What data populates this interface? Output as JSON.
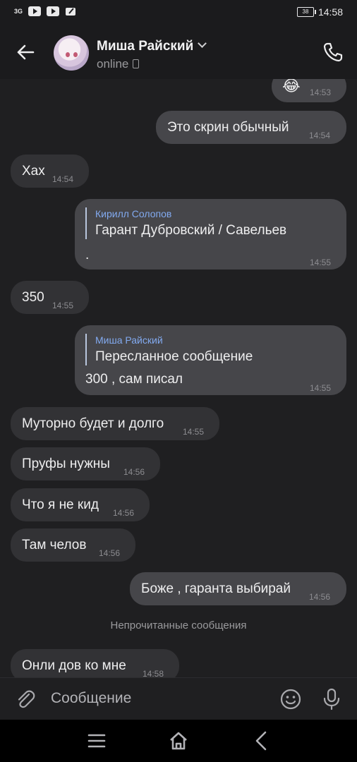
{
  "status_bar": {
    "signal": "3G",
    "battery": "38",
    "time": "14:58"
  },
  "header": {
    "contact_name": "Миша Райский",
    "status": "online"
  },
  "messages": [
    {
      "side": "out",
      "text": "😂",
      "time": "14:53"
    },
    {
      "side": "out",
      "text": "Это скрин обычный",
      "time": "14:54"
    },
    {
      "side": "in",
      "text": "Хах",
      "time": "14:54"
    },
    {
      "side": "out",
      "quote_author": "Кирилл Солопов",
      "quote_text": "Гарант Дубровский / Савельев",
      "text": ".",
      "time": "14:55"
    },
    {
      "side": "in",
      "text": "350",
      "time": "14:55"
    },
    {
      "side": "out",
      "quote_author": "Миша Райский",
      "quote_text": "Пересланное сообщение",
      "text": "300 , сам писал",
      "time": "14:55"
    },
    {
      "side": "in",
      "text": "Муторно будет и долго",
      "time": "14:55"
    },
    {
      "side": "in",
      "text": "Пруфы нужны",
      "time": "14:56"
    },
    {
      "side": "in",
      "text": "Что я не кид",
      "time": "14:56"
    },
    {
      "side": "in",
      "text": "Там челов",
      "time": "14:56"
    },
    {
      "side": "out",
      "text": "Боже , гаранта выбирай",
      "time": "14:56"
    },
    {
      "side": "in",
      "text": "Онли дов ко мне",
      "time": "14:58"
    }
  ],
  "unread_divider": "Непрочитанные сообщения",
  "composer": {
    "placeholder": "Сообщение"
  },
  "colors": {
    "background": "#1f1f21",
    "bubble_out": "#46464a",
    "bubble_in": "#323235",
    "quote_author": "#82aaf0"
  }
}
